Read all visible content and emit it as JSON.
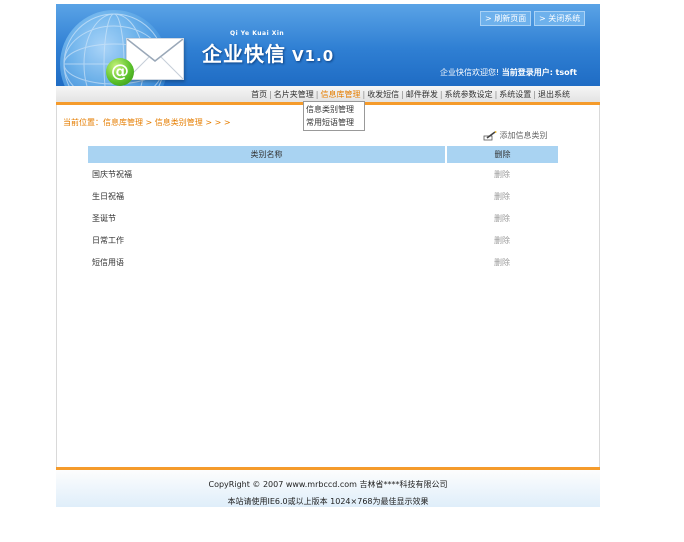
{
  "header": {
    "pinyin": "Qi Ye Kuai Xin",
    "title": "企业快信",
    "version": "V1.0",
    "refresh_button": "> 刷新页面",
    "close_button": "> 关闭系统",
    "welcome": "企业快信欢迎您!",
    "user_label": "当前登录用户:",
    "username": "tsoft"
  },
  "nav": {
    "items": [
      {
        "label": "首页"
      },
      {
        "label": "名片夹管理"
      },
      {
        "label": "信息库管理",
        "active": true
      },
      {
        "label": "收发短信"
      },
      {
        "label": "邮件群发"
      },
      {
        "label": "系统参数设定"
      },
      {
        "label": "系统设置"
      },
      {
        "label": "退出系统"
      }
    ],
    "dropdown": [
      "信息类别管理",
      "常用短语管理"
    ]
  },
  "breadcrumb": "当前位置：信息库管理 > 信息类别管理 > > >",
  "add_category": "添加信息类别",
  "table": {
    "headers": [
      "类别名称",
      "删除"
    ],
    "rows": [
      {
        "name": "国庆节祝福",
        "action": "删除"
      },
      {
        "name": "生日祝福",
        "action": "删除"
      },
      {
        "name": "圣诞节",
        "action": "删除"
      },
      {
        "name": "日常工作",
        "action": "删除"
      },
      {
        "name": "短信用语",
        "action": "删除"
      }
    ]
  },
  "footer": {
    "copyright": "CopyRight © 2007 www.mrbccd.com 吉林省****科技有限公司",
    "note": "本站请使用IE6.0或以上版本 1024×768为最佳显示效果"
  },
  "colors": {
    "header_blue": "#2f7fd3",
    "accent_orange": "#f59b2b",
    "table_header": "#a9d3f2"
  }
}
